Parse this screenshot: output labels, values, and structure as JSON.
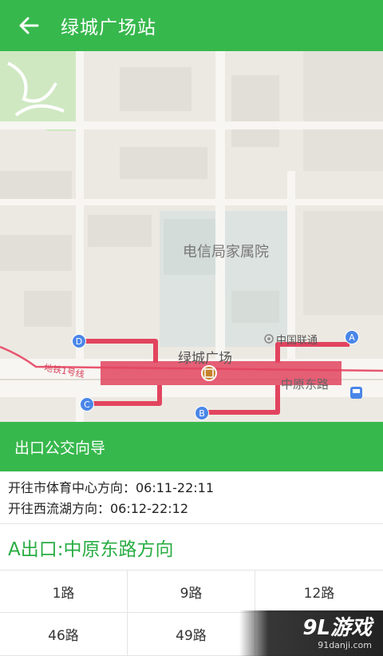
{
  "header": {
    "title": "绿城广场站"
  },
  "map": {
    "labels": {
      "compound": "电信局家属院",
      "station": "绿城广场",
      "poi": "中国联通",
      "road": "中原东路",
      "metro_line": "地铁1号线"
    },
    "exits": [
      "A",
      "B",
      "C",
      "D"
    ],
    "colors": {
      "route": "#e2445f",
      "exit_marker": "#4a86e8",
      "metro": "#e85670"
    }
  },
  "guide": {
    "title": "出口公交向导"
  },
  "schedule": [
    "开往市体育中心方向：06:11-22:11",
    "开往西流湖方向：06:12-22:12"
  ],
  "exit_section": {
    "title": "A出口:中原东路方向"
  },
  "routes": [
    "1路",
    "9路",
    "12路",
    "46路",
    "49路",
    ""
  ],
  "watermark": {
    "brand": "9L游戏",
    "site": "91danji.com"
  }
}
